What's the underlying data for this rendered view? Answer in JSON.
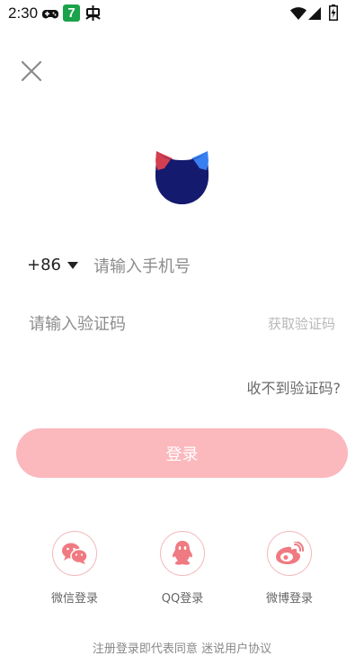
{
  "status_bar": {
    "time": "2:30",
    "notification_badge": "7",
    "icons": [
      "gamepad-icon",
      "app-7-icon",
      "bug-icon",
      "wifi-icon",
      "signal-icon",
      "battery-icon"
    ]
  },
  "login": {
    "country_code": "+86",
    "phone_placeholder": "请输入手机号",
    "code_placeholder": "请输入验证码",
    "get_code_label": "获取验证码",
    "no_code_label": "收不到验证码?",
    "login_button_label": "登录"
  },
  "social": [
    {
      "label": "微信登录",
      "icon": "wechat-icon"
    },
    {
      "label": "QQ登录",
      "icon": "qq-icon"
    },
    {
      "label": "微博登录",
      "icon": "weibo-icon"
    }
  ],
  "agreement": {
    "prefix": "注册登录即代表同意",
    "link": "迷说用户协议"
  },
  "colors": {
    "accent_pink": "#fbb8bd",
    "icon_pink": "#f07a82",
    "logo_navy": "#141a6e",
    "logo_red": "#e8434e",
    "logo_blue": "#3c8bff"
  }
}
